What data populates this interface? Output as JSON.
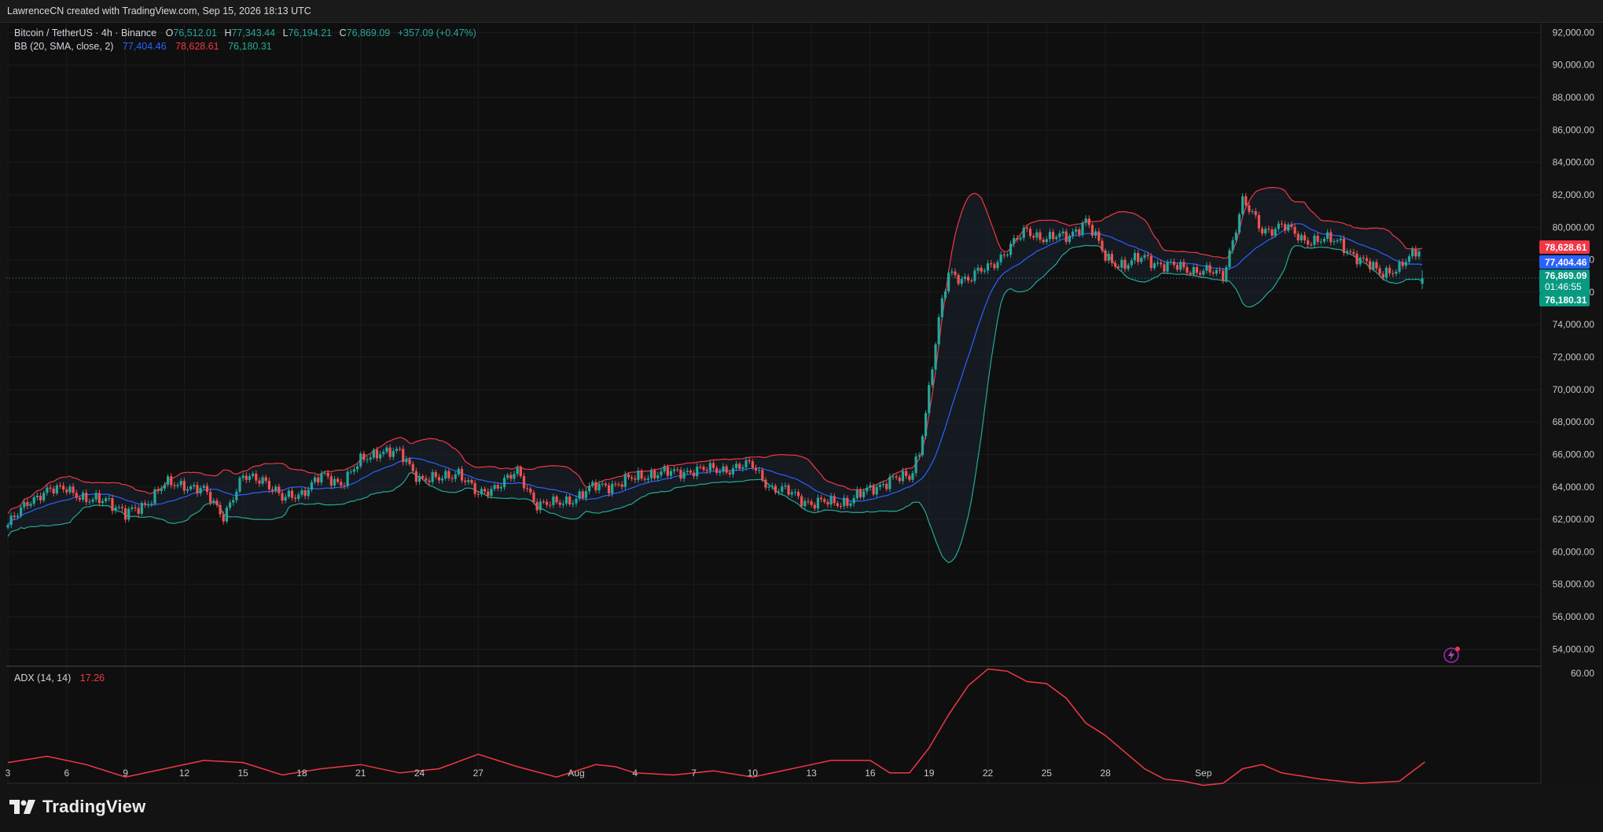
{
  "attribution": "LawrenceCN created with TradingView.com, Sep 15, 2026 18:13 UTC",
  "brand": "TradingView",
  "colors": {
    "background": "#0f0f0f",
    "up": "#26a69a",
    "down": "#ef5350",
    "basis": "#2962ff",
    "upper": "#f23645",
    "lower": "#22ab94",
    "adx": "#f23645"
  },
  "legend": {
    "symbol": "Bitcoin / TetherUS · 4h · Binance",
    "o_label": "O",
    "o": "76,512.01",
    "h_label": "H",
    "h": "77,343.44",
    "l_label": "L",
    "l": "76,194.21",
    "c_label": "C",
    "c": "76,869.09",
    "change": "+357.09 (+0.47%)",
    "bb_label": "BB (20, SMA, close, 2)",
    "bb_basis": "77,404.46",
    "bb_upper": "78,628.61",
    "bb_lower": "76,180.31",
    "adx_label": "ADX (14, 14)",
    "adx_value": "17.26"
  },
  "price_tags": {
    "upper": "78,628.61",
    "basis": "77,404.46",
    "last": "76,869.09",
    "countdown": "01:46:55",
    "lower": "76,180.31"
  },
  "chart_data": [
    {
      "type": "candlestick",
      "title": "Bitcoin / TetherUS · 4h · Binance",
      "y_ticks": [
        "92,000.00",
        "90,000.00",
        "88,000.00",
        "86,000.00",
        "84,000.00",
        "82,000.00",
        "80,000.00",
        "78,000.00",
        "76,000.00",
        "74,000.00",
        "72,000.00",
        "70,000.00",
        "68,000.00",
        "66,000.00",
        "64,000.00",
        "62,000.00",
        "60,000.00",
        "58,000.00",
        "56,000.00",
        "54,000.00"
      ],
      "x_ticks": [
        "3",
        "6",
        "9",
        "12",
        "15",
        "18",
        "21",
        "24",
        "27",
        "Aug",
        "4",
        "7",
        "10",
        "13",
        "16",
        "19",
        "22",
        "25",
        "28",
        "Sep"
      ],
      "x_tick_days": [
        3,
        6,
        9,
        12,
        15,
        18,
        21,
        24,
        27,
        32,
        35,
        38,
        41,
        44,
        47,
        50,
        53,
        56,
        59,
        64
      ],
      "x_range_days": [
        3,
        75.5
      ],
      "ylim": [
        53000,
        92600
      ],
      "grid": true,
      "anchors": [
        [
          3,
          61500
        ],
        [
          4,
          63200
        ],
        [
          5,
          63600
        ],
        [
          6,
          64100
        ],
        [
          7,
          63000
        ],
        [
          8,
          63400
        ],
        [
          9,
          62200
        ],
        [
          10,
          63000
        ],
        [
          11,
          64100
        ],
        [
          12,
          64200
        ],
        [
          13,
          63700
        ],
        [
          14,
          62300
        ],
        [
          15,
          64500
        ],
        [
          16,
          64600
        ],
        [
          17,
          63200
        ],
        [
          18,
          63700
        ],
        [
          19,
          64600
        ],
        [
          20,
          64300
        ],
        [
          21,
          65500
        ],
        [
          22,
          66300
        ],
        [
          23,
          66000
        ],
        [
          24,
          64600
        ],
        [
          25,
          64400
        ],
        [
          26,
          65000
        ],
        [
          27,
          63400
        ],
        [
          28,
          64200
        ],
        [
          29,
          64800
        ],
        [
          30,
          63000
        ],
        [
          31,
          62900
        ],
        [
          32,
          63400
        ],
        [
          33,
          64000
        ],
        [
          34,
          64200
        ],
        [
          35,
          64500
        ],
        [
          36,
          64900
        ],
        [
          37,
          64800
        ],
        [
          38,
          65100
        ],
        [
          39,
          65000
        ],
        [
          40,
          65200
        ],
        [
          41,
          65300
        ],
        [
          42,
          63900
        ],
        [
          43,
          63600
        ],
        [
          44,
          63000
        ],
        [
          45,
          63000
        ],
        [
          46,
          63200
        ],
        [
          47,
          63800
        ],
        [
          48,
          64500
        ],
        [
          49,
          64500
        ],
        [
          49.5,
          66200
        ],
        [
          50,
          70000
        ],
        [
          50.5,
          74200
        ],
        [
          51,
          77200
        ],
        [
          52,
          76800
        ],
        [
          53,
          77500
        ],
        [
          54,
          78600
        ],
        [
          55,
          79800
        ],
        [
          56,
          79300
        ],
        [
          57,
          79400
        ],
        [
          58,
          80400
        ],
        [
          59,
          78200
        ],
        [
          60,
          77600
        ],
        [
          61,
          78200
        ],
        [
          62,
          77600
        ],
        [
          63,
          77500
        ],
        [
          64,
          77300
        ],
        [
          65,
          77000
        ],
        [
          66,
          81600
        ],
        [
          67,
          79800
        ],
        [
          68,
          80100
        ],
        [
          69,
          79300
        ],
        [
          70,
          79200
        ],
        [
          71,
          79100
        ],
        [
          72,
          77900
        ],
        [
          73,
          77300
        ],
        [
          74,
          77400
        ],
        [
          75,
          78700
        ],
        [
          75.3,
          76900
        ]
      ],
      "series": [
        {
          "name": "Bitcoin / TetherUS",
          "kind": "ohlc"
        },
        {
          "name": "BB basis (20 SMA)",
          "last": 77404.46
        },
        {
          "name": "BB upper",
          "last": 78628.61
        },
        {
          "name": "BB lower",
          "last": 76180.31
        }
      ],
      "last_ohlc": {
        "open": 76512.01,
        "high": 77343.44,
        "low": 76194.21,
        "close": 76869.09
      }
    },
    {
      "type": "line",
      "title": "ADX (14, 14)",
      "y_ticks": [
        "60.00"
      ],
      "ylim": [
        7,
        63
      ],
      "points": [
        [
          3,
          17
        ],
        [
          5,
          20
        ],
        [
          7,
          16
        ],
        [
          9,
          10
        ],
        [
          11,
          14
        ],
        [
          13,
          18
        ],
        [
          15,
          17
        ],
        [
          17,
          11
        ],
        [
          19,
          14
        ],
        [
          21,
          16
        ],
        [
          23,
          12
        ],
        [
          25,
          14
        ],
        [
          27,
          21
        ],
        [
          29,
          15
        ],
        [
          31,
          10
        ],
        [
          32,
          13
        ],
        [
          33,
          16
        ],
        [
          34,
          15
        ],
        [
          35,
          12
        ],
        [
          37,
          11
        ],
        [
          39,
          13
        ],
        [
          41,
          10
        ],
        [
          43,
          14
        ],
        [
          45,
          18
        ],
        [
          47,
          18
        ],
        [
          48,
          12
        ],
        [
          49,
          12
        ],
        [
          50,
          24
        ],
        [
          51,
          40
        ],
        [
          52,
          54
        ],
        [
          53,
          62
        ],
        [
          54,
          61
        ],
        [
          55,
          56
        ],
        [
          56,
          55
        ],
        [
          57,
          48
        ],
        [
          58,
          36
        ],
        [
          59,
          30
        ],
        [
          60,
          22
        ],
        [
          61,
          14
        ],
        [
          62,
          9
        ],
        [
          63,
          8
        ],
        [
          64,
          6
        ],
        [
          65,
          7
        ],
        [
          66,
          14
        ],
        [
          67,
          16
        ],
        [
          68,
          12
        ],
        [
          70,
          9
        ],
        [
          72,
          7
        ],
        [
          74,
          8
        ],
        [
          75.3,
          17.26
        ]
      ],
      "last": 17.26
    }
  ]
}
